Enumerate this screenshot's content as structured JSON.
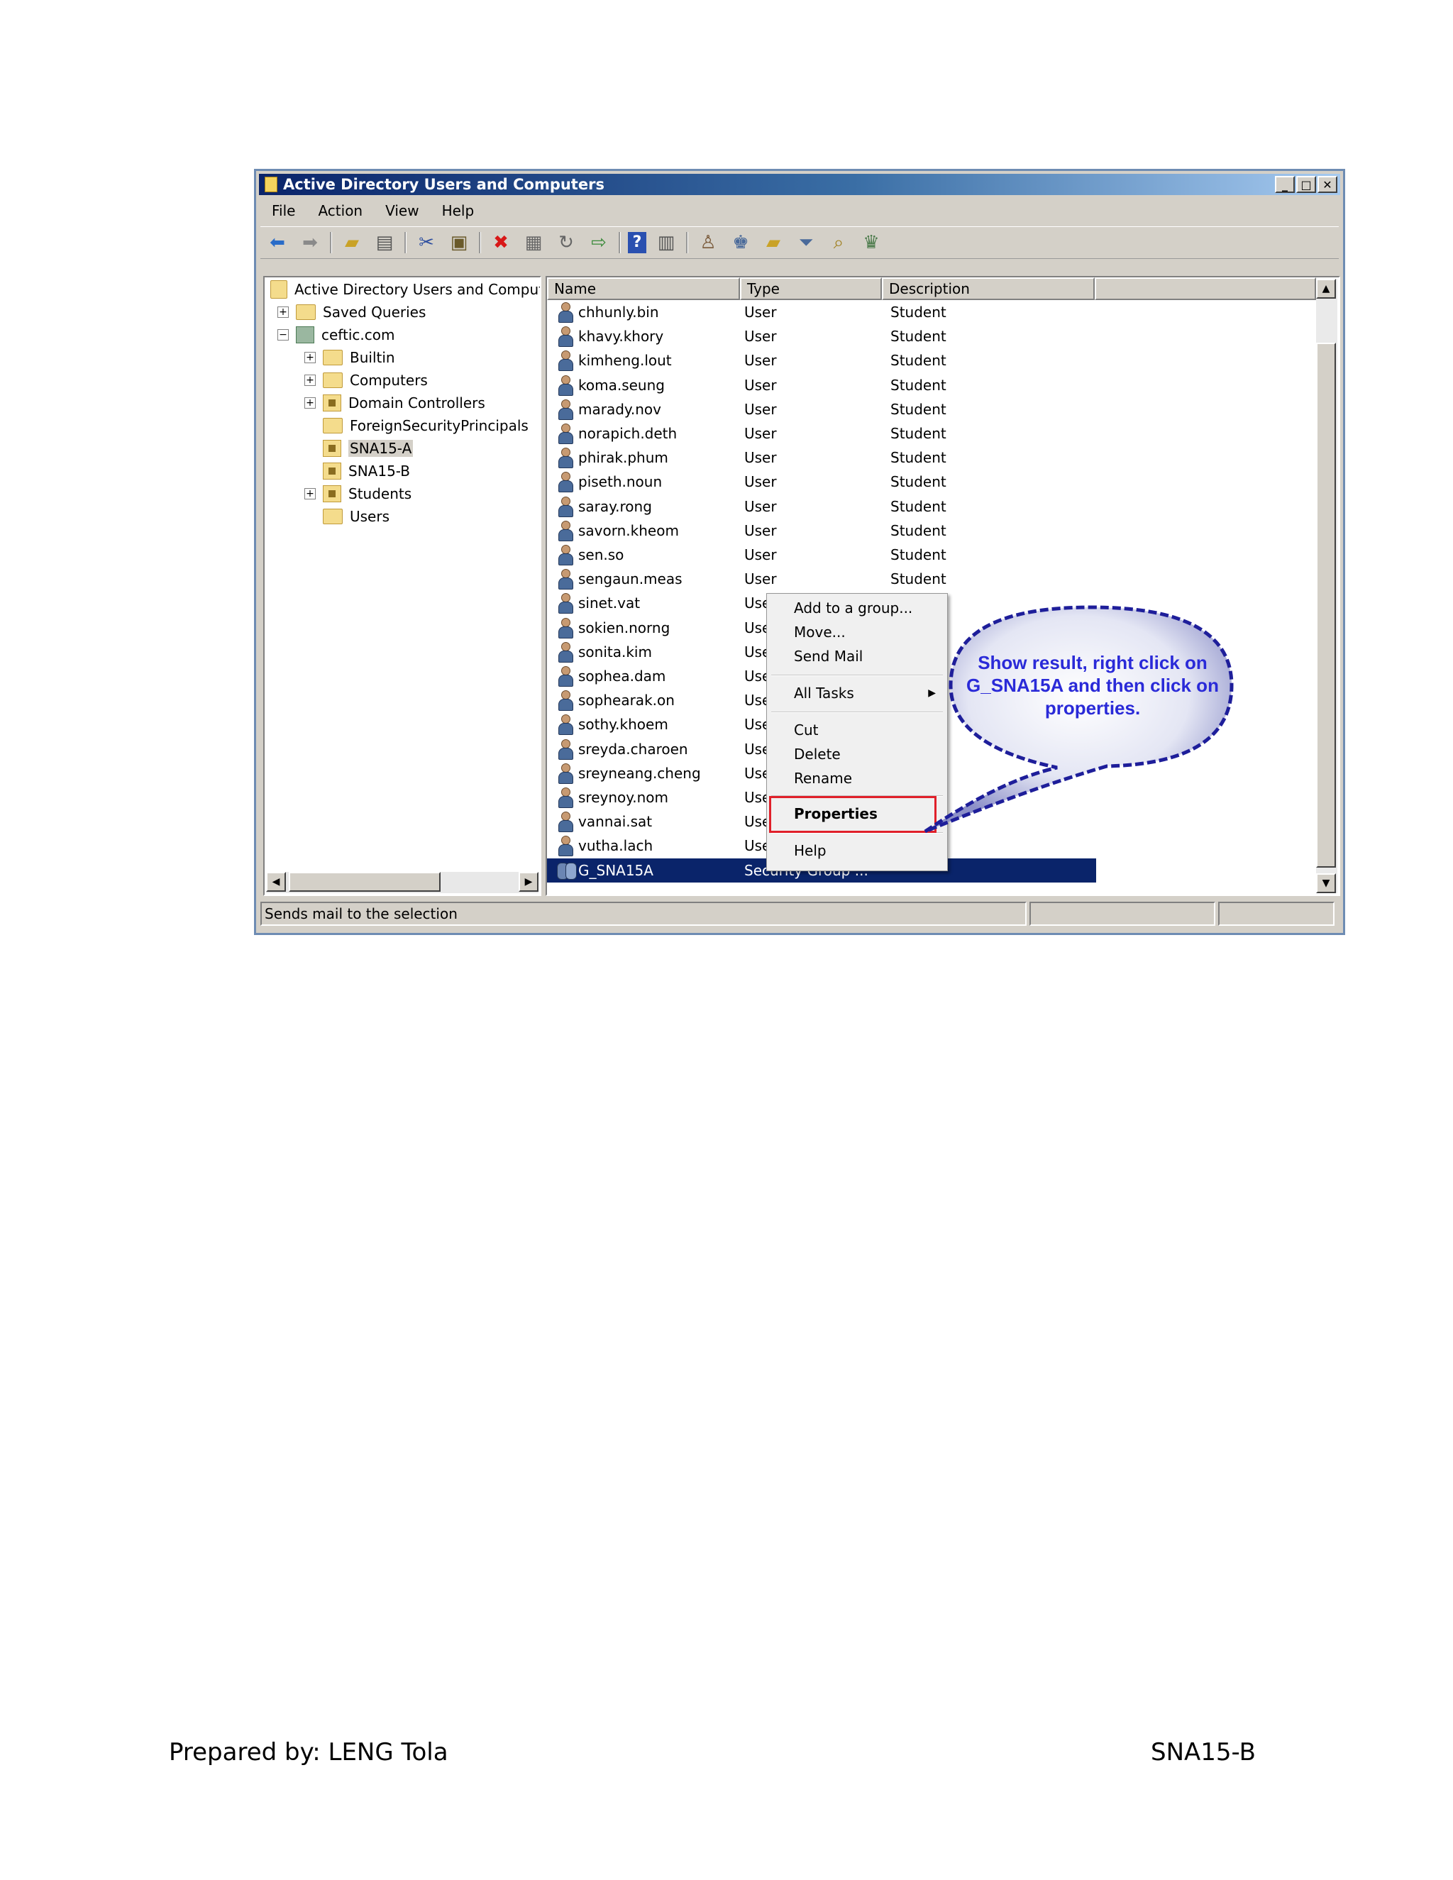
{
  "window": {
    "title": "Active Directory Users and Computers",
    "controls": {
      "minimize": "_",
      "maximize": "□",
      "close": "✕"
    }
  },
  "menubar": [
    "File",
    "Action",
    "View",
    "Help"
  ],
  "toolbar_icons": [
    "back-arrow-icon",
    "forward-arrow-icon",
    "up-folder-icon",
    "show-tree-icon",
    "cut-icon",
    "paste-icon",
    "delete-icon",
    "properties-icon",
    "refresh-icon",
    "export-icon",
    "help-icon",
    "console-icon",
    "new-user-icon",
    "new-group-icon",
    "new-ou-icon",
    "filter-icon",
    "find-icon",
    "add-to-group-icon"
  ],
  "tree": {
    "root": "Active Directory Users and Comput",
    "items": [
      {
        "label": "Saved Queries",
        "expander": "+",
        "icon": "folder"
      },
      {
        "label": "ceftic.com",
        "expander": "−",
        "icon": "domain"
      },
      {
        "label": "Builtin",
        "expander": "+",
        "icon": "folder"
      },
      {
        "label": "Computers",
        "expander": "+",
        "icon": "folder"
      },
      {
        "label": "Domain Controllers",
        "expander": "+",
        "icon": "ou"
      },
      {
        "label": "ForeignSecurityPrincipals",
        "expander": "",
        "icon": "folder"
      },
      {
        "label": "SNA15-A",
        "expander": "",
        "icon": "ou",
        "selected": true
      },
      {
        "label": "SNA15-B",
        "expander": "",
        "icon": "ou"
      },
      {
        "label": "Students",
        "expander": "+",
        "icon": "ou"
      },
      {
        "label": "Users",
        "expander": "",
        "icon": "folder"
      }
    ]
  },
  "list": {
    "columns": [
      "Name",
      "Type",
      "Description",
      ""
    ],
    "rows": [
      {
        "name": "chhunly.bin",
        "type": "User",
        "desc": "Student"
      },
      {
        "name": "khavy.khory",
        "type": "User",
        "desc": "Student"
      },
      {
        "name": "kimheng.lout",
        "type": "User",
        "desc": "Student"
      },
      {
        "name": "koma.seung",
        "type": "User",
        "desc": "Student"
      },
      {
        "name": "marady.nov",
        "type": "User",
        "desc": "Student"
      },
      {
        "name": "norapich.deth",
        "type": "User",
        "desc": "Student"
      },
      {
        "name": "phirak.phum",
        "type": "User",
        "desc": "Student"
      },
      {
        "name": "piseth.noun",
        "type": "User",
        "desc": "Student"
      },
      {
        "name": "saray.rong",
        "type": "User",
        "desc": "Student"
      },
      {
        "name": "savorn.kheom",
        "type": "User",
        "desc": "Student"
      },
      {
        "name": "sen.so",
        "type": "User",
        "desc": "Student"
      },
      {
        "name": "sengaun.meas",
        "type": "User",
        "desc": "Student"
      },
      {
        "name": "sinet.vat",
        "type": "Use",
        "desc": ""
      },
      {
        "name": "sokien.norng",
        "type": "Use",
        "desc": ""
      },
      {
        "name": "sonita.kim",
        "type": "Use",
        "desc": ""
      },
      {
        "name": "sophea.dam",
        "type": "Use",
        "desc": ""
      },
      {
        "name": "sophearak.on",
        "type": "Use",
        "desc": ""
      },
      {
        "name": "sothy.khoem",
        "type": "Use",
        "desc": ""
      },
      {
        "name": "sreyda.charoen",
        "type": "Use",
        "desc": ""
      },
      {
        "name": "sreyneang.cheng",
        "type": "Use",
        "desc": ""
      },
      {
        "name": "sreynoy.nom",
        "type": "Use",
        "desc": ""
      },
      {
        "name": "vannai.sat",
        "type": "Use",
        "desc": ""
      },
      {
        "name": "vutha.lach",
        "type": "Use",
        "desc": ""
      },
      {
        "name": "G_SNA15A",
        "type": "Security Group ...",
        "desc": "",
        "group": true,
        "selected": true
      }
    ]
  },
  "context_menu": {
    "add_to_group": "Add to a group...",
    "move": "Move...",
    "send_mail": "Send Mail",
    "all_tasks": "All Tasks",
    "cut": "Cut",
    "delete": "Delete",
    "rename": "Rename",
    "properties": "Properties",
    "help": "Help"
  },
  "callout": {
    "text": "Show result, right click on G_SNA15A and then click on properties."
  },
  "statusbar": {
    "text": "Sends mail to the selection"
  },
  "footer": {
    "left": "Prepared by: LENG Tola",
    "right": "SNA15-B"
  },
  "colors": {
    "title_start": "#0a246a",
    "selection": "#0a246a",
    "highlight_box": "#e0202a",
    "callout_text": "#2a2ad8",
    "callout_border": "#1e1e9a"
  }
}
